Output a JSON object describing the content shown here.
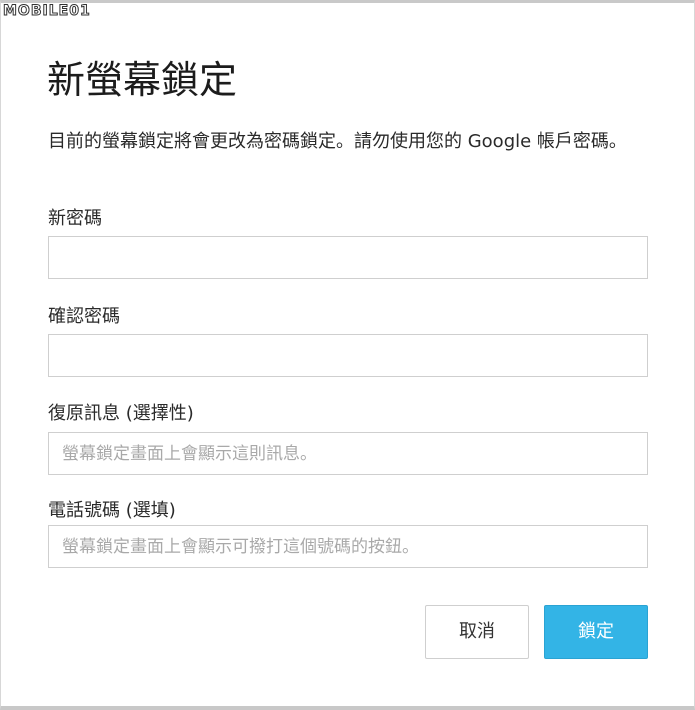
{
  "watermark": "MOBILE01",
  "dialog": {
    "title": "新螢幕鎖定",
    "description": "目前的螢幕鎖定將會更改為密碼鎖定。請勿使用您的 Google 帳戶密碼。"
  },
  "fields": {
    "new_password": {
      "label": "新密碼",
      "value": "",
      "placeholder": ""
    },
    "confirm_password": {
      "label": "確認密碼",
      "value": "",
      "placeholder": ""
    },
    "recovery_message": {
      "label": "復原訊息 (選擇性)",
      "value": "",
      "placeholder": "螢幕鎖定畫面上會顯示這則訊息。"
    },
    "phone_number": {
      "label": "電話號碼 (選填)",
      "value": "",
      "placeholder": "螢幕鎖定畫面上會顯示可撥打這個號碼的按鈕。"
    }
  },
  "buttons": {
    "cancel_label": "取消",
    "lock_label": "鎖定"
  },
  "colors": {
    "accent": "#33b4e6",
    "border": "#cfcfcf",
    "placeholder": "#a9a9a9"
  }
}
